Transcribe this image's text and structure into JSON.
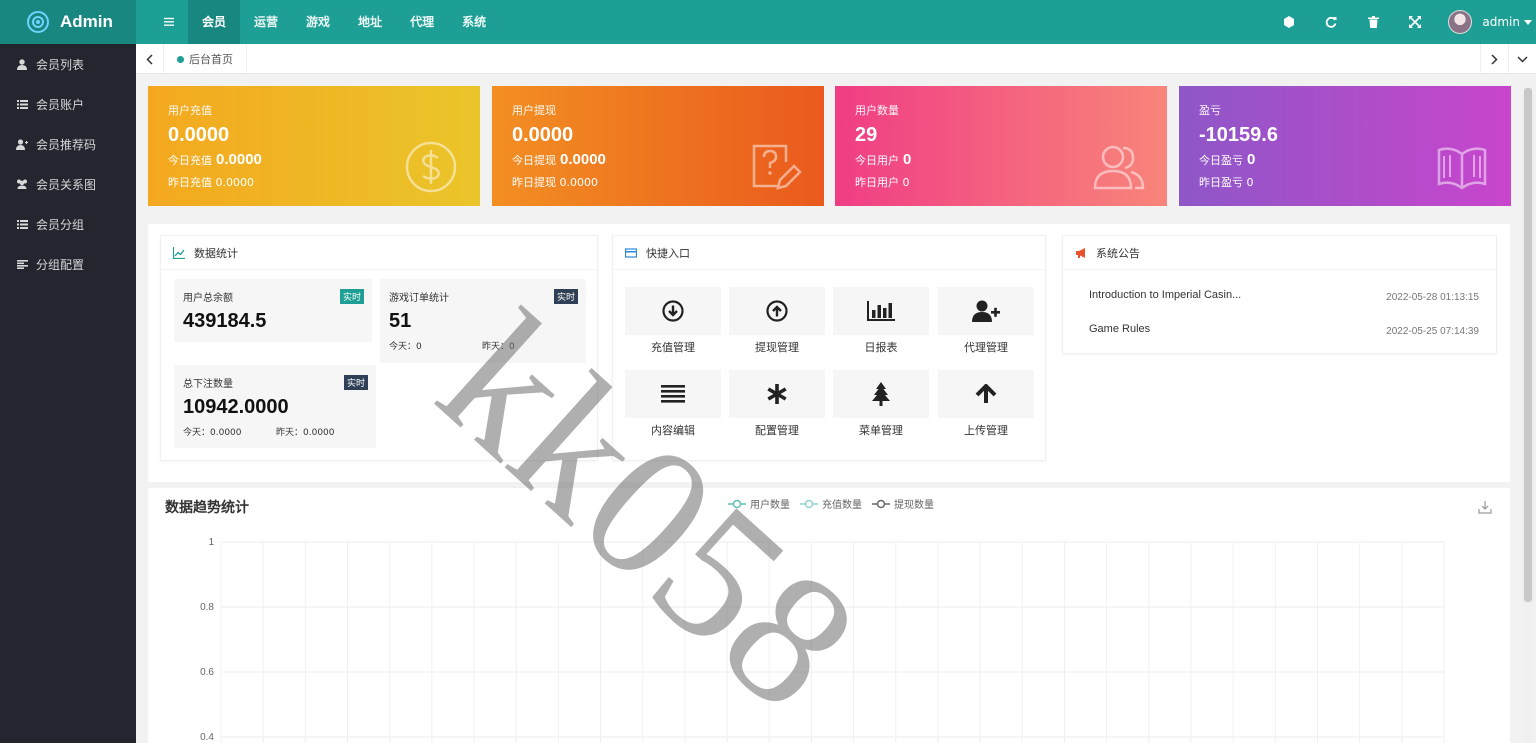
{
  "app": {
    "logo_text": "Admin"
  },
  "topnav": {
    "items": [
      "会员",
      "运营",
      "游戏",
      "地址",
      "代理",
      "系统"
    ],
    "active": 0
  },
  "user": {
    "name": "admin"
  },
  "sidebar": {
    "items": [
      {
        "label": "会员列表",
        "icon": "user-icon"
      },
      {
        "label": "会员账户",
        "icon": "list-icon"
      },
      {
        "label": "会员推荐码",
        "icon": "add-user-icon"
      },
      {
        "label": "会员关系图",
        "icon": "users-icon"
      },
      {
        "label": "会员分组",
        "icon": "list-icon"
      },
      {
        "label": "分组配置",
        "icon": "align-icon"
      }
    ]
  },
  "tabs": {
    "home_label": "后台首页"
  },
  "cards": [
    {
      "title": "用户充值",
      "value": "0.0000",
      "today_label": "今日充值",
      "today_value": "0.0000",
      "yesterday_label": "昨日充值",
      "yesterday_value": "0.0000",
      "icon": "dollar-icon",
      "colors": [
        "#f4a81f",
        "#eac52a"
      ]
    },
    {
      "title": "用户提现",
      "value": "0.0000",
      "today_label": "今日提现",
      "today_value": "0.0000",
      "yesterday_label": "昨日提现",
      "yesterday_value": "0.0000",
      "icon": "question-edit-icon",
      "colors": [
        "#f28f22",
        "#ea5a1e"
      ]
    },
    {
      "title": "用户数量",
      "value": "29",
      "today_label": "今日用户",
      "today_value": "0",
      "yesterday_label": "昨日用户",
      "yesterday_value": "0",
      "icon": "users-icon",
      "colors": [
        "#f03d85",
        "#f8857a"
      ]
    },
    {
      "title": "盈亏",
      "value": "-10159.6",
      "today_label": "今日盈亏",
      "today_value": "0",
      "yesterday_label": "昨日盈亏",
      "yesterday_value": "0",
      "icon": "book-icon",
      "colors": [
        "#8e57c8",
        "#c845cc"
      ]
    }
  ],
  "stats_panel": {
    "title": "数据统计",
    "boxes": [
      {
        "title": "用户总余额",
        "badge": "实时",
        "badge_color": "#1e9f95",
        "value": "439184.5"
      },
      {
        "title": "游戏订单统计",
        "badge": "实时",
        "badge_color": "#2f4056",
        "value": "51",
        "today": "今天：0",
        "yesterday": "昨天：0"
      },
      {
        "title": "总下注数量",
        "badge": "实时",
        "badge_color": "#2f4056",
        "value": "10942.0000",
        "today": "今天：0.0000",
        "yesterday": "昨天：0.0000"
      }
    ]
  },
  "quick_panel": {
    "title": "快捷入口",
    "items": [
      {
        "label": "充值管理",
        "icon": "download-circle-icon"
      },
      {
        "label": "提现管理",
        "icon": "upload-circle-icon"
      },
      {
        "label": "日报表",
        "icon": "bar-chart-icon"
      },
      {
        "label": "代理管理",
        "icon": "add-user-icon"
      },
      {
        "label": "内容编辑",
        "icon": "lines-icon"
      },
      {
        "label": "配置管理",
        "icon": "asterisk-icon"
      },
      {
        "label": "菜单管理",
        "icon": "tree-icon"
      },
      {
        "label": "上传管理",
        "icon": "arrow-up-icon"
      }
    ]
  },
  "notice_panel": {
    "title": "系统公告",
    "items": [
      {
        "title": "Introduction to Imperial Casin...",
        "date": "2022-05-28 01:13:15"
      },
      {
        "title": "Game Rules",
        "date": "2022-05-25 07:14:39"
      }
    ]
  },
  "watermark": {
    "text": "kk058"
  },
  "chart_data": {
    "type": "line",
    "title": "数据趋势统计",
    "series": [
      {
        "name": "用户数量",
        "color": "#5fc1b6",
        "values": []
      },
      {
        "name": "充值数量",
        "color": "#8fd3cf",
        "values": []
      },
      {
        "name": "提现数量",
        "color": "#666666",
        "values": []
      }
    ],
    "y_ticks": [
      "1",
      "0.8",
      "0.6",
      "0.4"
    ],
    "ylim": [
      0,
      1
    ],
    "grid": true
  }
}
